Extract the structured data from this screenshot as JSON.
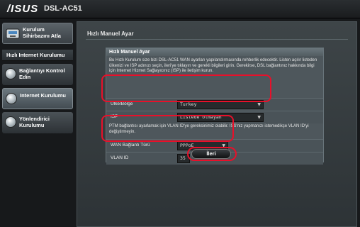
{
  "header": {
    "logo": "/ISUS",
    "model": "DSL-AC51"
  },
  "sidebar": {
    "quick_setup": "Kurulum Sihirbazını Atla",
    "section_title": "Hızlı Internet Kurulumu",
    "items": [
      {
        "label": "Bağlantıyı Kontrol Edin",
        "icon": "globe-icon"
      },
      {
        "label": "Internet Kurulumu",
        "icon": "globe-icon",
        "active": true
      },
      {
        "label": "Yönlendirici Kurulumu",
        "icon": "globe-icon"
      }
    ]
  },
  "main": {
    "page_title": "Hızlı Manuel Ayar",
    "panel_title": "Hızlı Manuel Ayar",
    "description": "Bu Hızlı Kurulum size bizi DSL-AC51 WAN ayarları yapılandırmasında rehberlik edecektir. Listen açılır listeden ülkenizi ve ISP adınızı seçin, ileri'ye tıklayın ve gerekli bilgileri girin. Gerekirse, DSL bağlantınız hakkında bilgi için Internet Hizmet Sağlayıcınız (ISP) ile iletişim kurun.",
    "country_label": "Ülke/Bölge",
    "country_value": "Turkey",
    "isp_label": "ISP",
    "isp_value": "Listede olmayan",
    "ptm_note": "PTM bağlantısı ayarlamak için VLAN ID'ye gereksinimiz olabilir. ISS'niz yapmanızı istemedikçe VLAN ID'yi değiştirmeyin.",
    "wan_type_label": "WAN Bağlantı Türü",
    "wan_type_value": "PPPoE",
    "vlan_label": "VLAN ID",
    "vlan_value": "35",
    "next_label": "İleri"
  },
  "colors": {
    "highlight": "#e8102a",
    "background": "#17191b"
  }
}
